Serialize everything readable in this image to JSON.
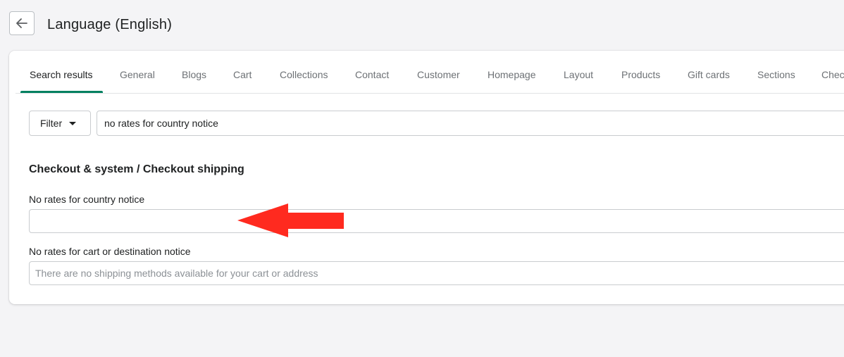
{
  "header": {
    "title": "Language (English)",
    "back_icon": "arrow-left-icon"
  },
  "tabs": [
    {
      "label": "Search results",
      "active": true
    },
    {
      "label": "General"
    },
    {
      "label": "Blogs"
    },
    {
      "label": "Cart"
    },
    {
      "label": "Collections"
    },
    {
      "label": "Contact"
    },
    {
      "label": "Customer"
    },
    {
      "label": "Homepage"
    },
    {
      "label": "Layout"
    },
    {
      "label": "Products"
    },
    {
      "label": "Gift cards"
    },
    {
      "label": "Sections"
    },
    {
      "label": "Chec"
    }
  ],
  "filter": {
    "label": "Filter",
    "search_value": "no rates for country notice"
  },
  "section": {
    "heading": "Checkout & system / Checkout shipping"
  },
  "fields": [
    {
      "label": "No rates for country notice",
      "value": "",
      "placeholder": ""
    },
    {
      "label": "No rates for cart or destination notice",
      "value": "",
      "placeholder": "There are no shipping methods available for your cart or address"
    }
  ],
  "annotation": {
    "icon": "red-arrow-left-icon",
    "color": "#ff2a1f"
  },
  "colors": {
    "accent": "#008060",
    "background": "#f4f4f6"
  }
}
